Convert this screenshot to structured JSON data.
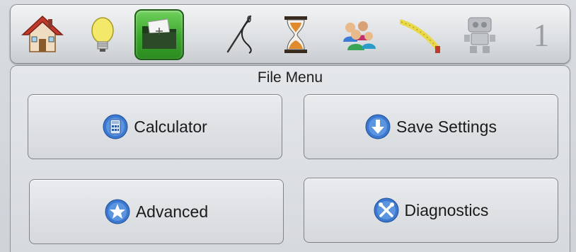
{
  "toolbar": {
    "icons": [
      {
        "name": "home-icon"
      },
      {
        "name": "lightbulb-icon"
      },
      {
        "name": "file-folder-icon",
        "active": true
      },
      {
        "name": "needle-thread-icon"
      },
      {
        "name": "hourglass-icon"
      },
      {
        "name": "users-icon"
      },
      {
        "name": "tape-measure-icon"
      },
      {
        "name": "robot-icon"
      }
    ],
    "page_number": "1",
    "active_color": "#3aa62c"
  },
  "panel": {
    "title": "File Menu"
  },
  "buttons": {
    "calculator": {
      "label": "Calculator",
      "icon": "calculator-icon"
    },
    "save_settings": {
      "label": "Save Settings",
      "icon": "download-arrow-icon"
    },
    "advanced": {
      "label": "Advanced",
      "icon": "star-icon"
    },
    "diagnostics": {
      "label": "Diagnostics",
      "icon": "tools-icon"
    }
  },
  "accent_color": "#2f6fc8"
}
